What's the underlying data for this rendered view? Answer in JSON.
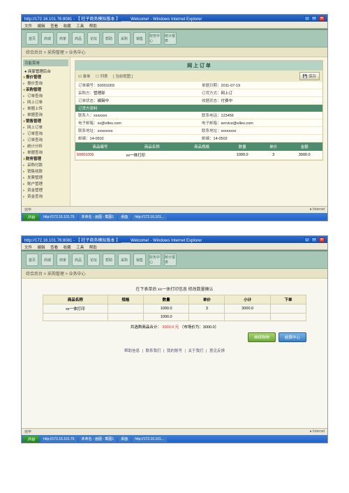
{
  "window": {
    "url": "http://172.16.101.76:8081",
    "title_suffix": "【 柱子商务模拟版本 】 ____Welcome! - Windows Internet Explorer",
    "menus": [
      "文件",
      "编辑",
      "查看",
      "收藏",
      "工具",
      "帮助"
    ],
    "status_left": "完毕",
    "status_right": "Internet"
  },
  "taskbar": {
    "start": "开始",
    "items": [
      "http://172.16.101.76",
      "未命名 - 画图 - 截图1",
      "桌面",
      "http://172.16.101..."
    ]
  },
  "toolbar_labels": [
    "首页",
    "商城",
    "商家",
    "商品",
    "论坛",
    "帮助",
    "采购",
    "销售",
    "财务中心",
    "统计报表"
  ],
  "crumb": "综合后台 > 采购管理 > 业务中心",
  "sidebar": {
    "head": "功能菜单",
    "root": "● 商家管理后台",
    "items": [
      {
        "t": "报价管理",
        "g": true
      },
      {
        "t": "报价查询"
      },
      {
        "t": "采购管理",
        "g": true
      },
      {
        "t": "订单查询"
      },
      {
        "t": "网上订单"
      },
      {
        "t": "单据上传"
      },
      {
        "t": "单据查询"
      },
      {
        "t": "销售管理",
        "g": true
      },
      {
        "t": "网上订单"
      },
      {
        "t": "订单查询"
      },
      {
        "t": "订单查询"
      },
      {
        "t": "统计分析"
      },
      {
        "t": "单据查询"
      },
      {
        "t": "财务管理",
        "g": true
      },
      {
        "t": "采购付款"
      },
      {
        "t": "销售收款"
      },
      {
        "t": "发票管理"
      },
      {
        "t": "账户管理"
      },
      {
        "t": "资金管理"
      },
      {
        "t": "资金查询"
      }
    ]
  },
  "order_panel": {
    "title": "网 上 订 单",
    "tabs": [
      "录单",
      "列表",
      "[ 当前视图 ]"
    ],
    "save_btn": "保存",
    "info_rows": [
      [
        "订单编号：",
        "50001003",
        "单据日期：",
        "2011-07-19"
      ],
      [
        "采购方：",
        "管理部",
        "订货方式：",
        "网上订"
      ],
      [
        "订单状态：",
        "编辑中",
        "收据状态：",
        "付费中"
      ]
    ],
    "buyer_head": "订货方资料",
    "buyer_rows": [
      [
        "联系人：",
        "xxxxxxx",
        "联系电话：",
        "123456"
      ],
      [
        "电子邮箱：",
        "xx@elles.com",
        "电子邮箱：",
        "service@elles.com"
      ],
      [
        "联系地址：",
        "xxxxxxxx",
        "联系地址：",
        "xxxxxxxx"
      ],
      [
        "邮编：",
        "14-0502",
        "邮编：",
        "14-0502"
      ]
    ],
    "columns": [
      "商品编号",
      "商品名称",
      "商品规格",
      "数量",
      "单价",
      "金额"
    ],
    "row": {
      "code": "50001006",
      "name": "xx一体打印",
      "spec": "",
      "qty": "1000.0",
      "price": "3",
      "amount": "3000.0"
    }
  },
  "cart": {
    "header": "在下表单后 xx一体打印信息 修改数量确认",
    "columns": [
      "商品名称",
      "规格",
      "数量",
      "单价",
      "小计",
      "下单"
    ],
    "row": {
      "name": "xx一体打印",
      "spec": "",
      "qty": "1000.0",
      "price": "3",
      "subtotal": "3000.0",
      "order": ""
    },
    "row2": [
      "",
      "",
      "1000.0",
      "",
      "",
      ""
    ],
    "total_prefix": "共选购商品合计：",
    "total": "3000.0 元",
    "total_suffix": "（市场价为：3000.0）",
    "btn_continue": "继续购物",
    "btn_checkout": "结算中心",
    "footer_links": [
      "帮助信息",
      "联系我们",
      "我的账号",
      "关于我们",
      "意见反馈"
    ]
  }
}
